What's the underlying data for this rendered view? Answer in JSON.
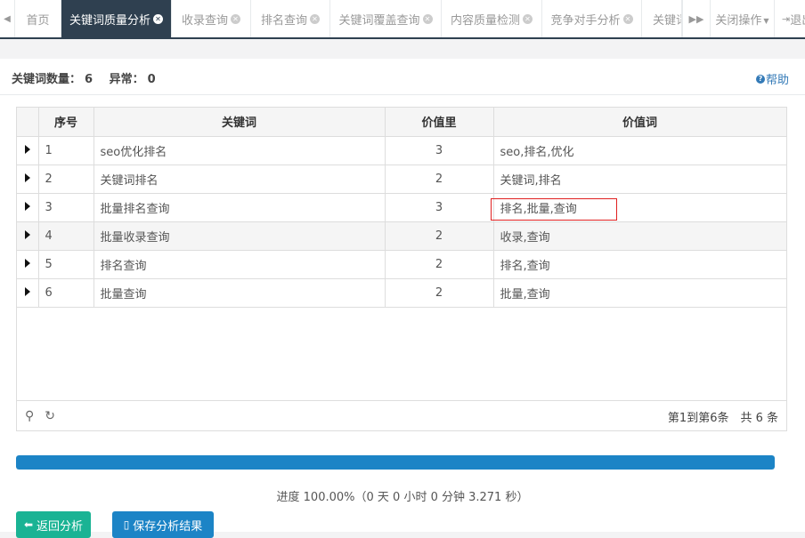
{
  "tabs": [
    {
      "label": "首页",
      "closable": false,
      "active": false
    },
    {
      "label": "关键词质量分析",
      "closable": true,
      "active": true
    },
    {
      "label": "收录查询",
      "closable": true,
      "active": false
    },
    {
      "label": "排名查询",
      "closable": true,
      "active": false
    },
    {
      "label": "关键词覆盖查询",
      "closable": true,
      "active": false
    },
    {
      "label": "内容质量检测",
      "closable": true,
      "active": false
    },
    {
      "label": "竞争对手分析",
      "closable": true,
      "active": false
    },
    {
      "label": "关键词",
      "closable": false,
      "active": false
    }
  ],
  "tabbar": {
    "close_ops_label": "关闭操作",
    "logout_label": "退出"
  },
  "summary": {
    "count_label": "关键词数量：",
    "count_value": "6",
    "error_label": "异常：",
    "error_value": "0",
    "help_label": "帮助"
  },
  "table": {
    "headers": [
      "序号",
      "关键词",
      "价值里",
      "价值词"
    ],
    "rows": [
      {
        "index": "1",
        "keyword": "seo优化排名",
        "value": "3",
        "words": "seo,排名,优化"
      },
      {
        "index": "2",
        "keyword": "关键词排名",
        "value": "2",
        "words": "关键词,排名"
      },
      {
        "index": "3",
        "keyword": "批量排名查询",
        "value": "3",
        "words": "排名,批量,查询"
      },
      {
        "index": "4",
        "keyword": "批量收录查询",
        "value": "2",
        "words": "收录,查询"
      },
      {
        "index": "5",
        "keyword": "排名查询",
        "value": "2",
        "words": "排名,查询"
      },
      {
        "index": "6",
        "keyword": "批量查询",
        "value": "2",
        "words": "批量,查询"
      }
    ],
    "pagination": "第1到第6条　共 6 条"
  },
  "progress": {
    "percent": 100,
    "text": "进度 100.00%（0 天 0 小时 0 分钟 3.271 秒）"
  },
  "buttons": {
    "back_label": "返回分析",
    "save_label": "保存分析结果"
  },
  "colors": {
    "active_tab": "#2f4050",
    "progress": "#1c84c6",
    "back_button": "#1ab394",
    "save_button": "#1c84c6",
    "highlight_box": "#e02020"
  },
  "icons": [
    "chevron-left-icon",
    "close-icon",
    "forward-icon",
    "caret-down-icon",
    "logout-icon",
    "question-icon",
    "caret-right-icon",
    "search-icon",
    "refresh-icon",
    "arrow-left-icon",
    "file-icon"
  ]
}
